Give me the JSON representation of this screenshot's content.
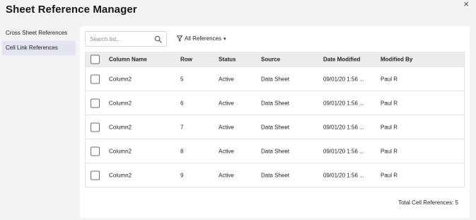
{
  "dialog": {
    "title": "Sheet Reference Manager",
    "close_label": "×"
  },
  "sidebar": {
    "items": [
      {
        "label": "Cross Sheet References",
        "active": false
      },
      {
        "label": "Cell Link References",
        "active": true
      }
    ]
  },
  "toolbar": {
    "search_placeholder": "Search list...",
    "filter_label": "All References",
    "filter_caret": "▾"
  },
  "table": {
    "headers": {
      "column_name": "Column Name",
      "row": "Row",
      "status": "Status",
      "source": "Source",
      "date_modified": "Date Modified",
      "modified_by": "Modified By"
    },
    "rows": [
      {
        "column_name": "Column2",
        "row": "5",
        "status": "Active",
        "source": "Data Sheet",
        "date_modified": "09/01/20 1:56 ...",
        "modified_by": "Paul R"
      },
      {
        "column_name": "Column2",
        "row": "6",
        "status": "Active",
        "source": "Data Sheet",
        "date_modified": "09/01/20 1:56 ...",
        "modified_by": "Paul R"
      },
      {
        "column_name": "Column2",
        "row": "7",
        "status": "Active",
        "source": "Data Sheet",
        "date_modified": "09/01/20 1:56 ...",
        "modified_by": "Paul R"
      },
      {
        "column_name": "Column2",
        "row": "8",
        "status": "Active",
        "source": "Data Sheet",
        "date_modified": "09/01/20 1:56 ...",
        "modified_by": "Paul R"
      },
      {
        "column_name": "Column2",
        "row": "9",
        "status": "Active",
        "source": "Data Sheet",
        "date_modified": "09/01/20 1:56 ...",
        "modified_by": "Paul R"
      }
    ]
  },
  "footer": {
    "total_label": "Total Cell References: 5"
  },
  "icons": {
    "search": "search-icon",
    "filter": "filter-icon",
    "close": "close-icon"
  },
  "colors": {
    "background": "#f3f3f3",
    "panel": "#ffffff",
    "active_sidebar": "#e3e4f2",
    "table_header": "#ececec"
  }
}
